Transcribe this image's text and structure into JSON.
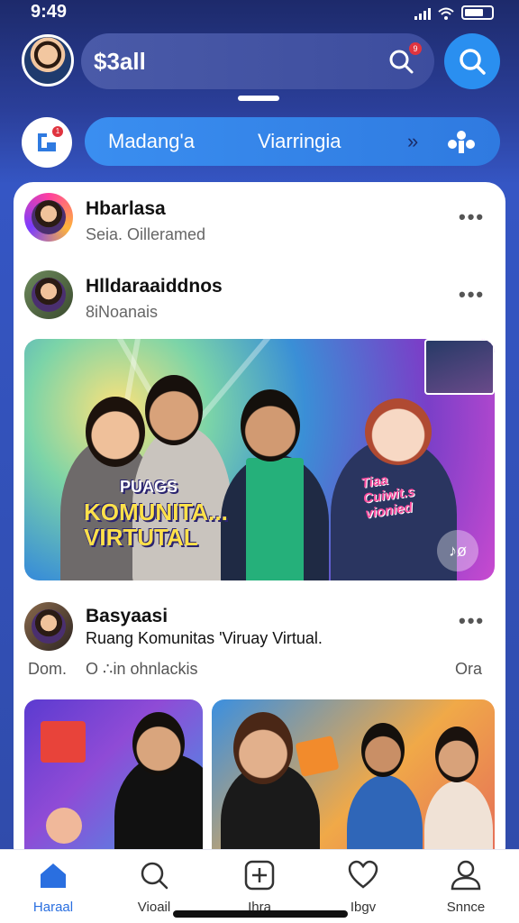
{
  "status_bar": {
    "time": "9:49"
  },
  "header": {
    "search_text": "$3all",
    "search_badge": "9"
  },
  "tabs": {
    "badge": "1",
    "items": [
      "Madang'a",
      "Viarringia"
    ],
    "more_symbol": "»"
  },
  "feed": {
    "posts": [
      {
        "name": "Hbarlasa",
        "sub": "Seia. Oilleramed"
      },
      {
        "name": "Hlldaraaiddnos",
        "sub": "8iNoanais"
      }
    ],
    "banner": {
      "title_small": "PUAGS",
      "title_line1": "KOMUNITA...",
      "title_line2": "VIRTUTAL",
      "tag_line1": "Tiaa",
      "tag_line2": "Cuiwit.s",
      "tag_line3": "vionied",
      "music_label": "♪ø"
    },
    "post3": {
      "name": "Basyaasi",
      "caption": "Ruang Komunitas 'Viruay Virtual.",
      "meta_left": "Dom.",
      "meta_mid": "O ∴in ohnlackis",
      "meta_right": "Ora"
    },
    "more_dots": "•••"
  },
  "bottom_nav": [
    {
      "label": "Haraal",
      "icon": "home-icon",
      "active": true
    },
    {
      "label": "Vioail",
      "icon": "search-icon",
      "active": false
    },
    {
      "label": "Ihra",
      "icon": "add-post-icon",
      "active": false
    },
    {
      "label": "Ibgv",
      "icon": "heart-icon",
      "active": false
    },
    {
      "label": "Snnce",
      "icon": "profile-icon",
      "active": false
    }
  ],
  "colors": {
    "accent": "#2a8ff0",
    "active_nav": "#2a6fe0",
    "background_top": "#1d2a6b"
  }
}
